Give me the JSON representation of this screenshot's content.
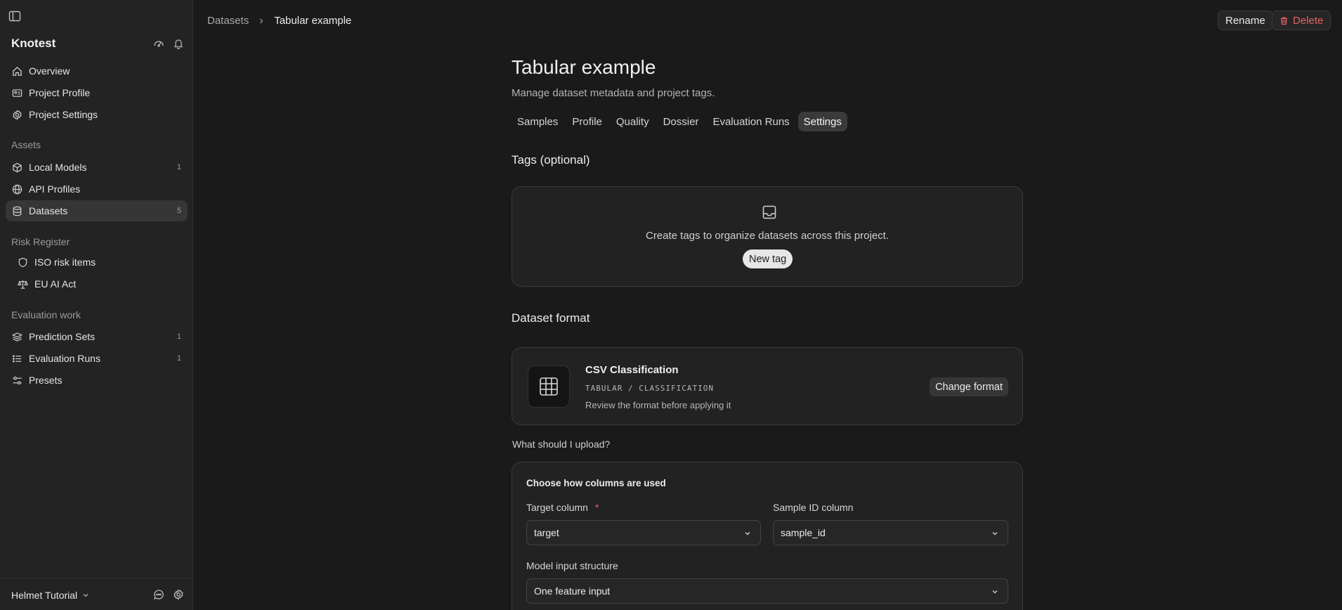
{
  "sidebar": {
    "title": "Knotest",
    "sections": {
      "assets": "Assets",
      "risk": "Risk Register",
      "evaluation": "Evaluation work"
    },
    "items": [
      {
        "label": "Overview",
        "icon": "home-icon"
      },
      {
        "label": "Project Profile",
        "icon": "id-card-icon"
      },
      {
        "label": "Project Settings",
        "icon": "gear-icon"
      },
      {
        "label": "Local Models",
        "icon": "cube-icon",
        "count": "1"
      },
      {
        "label": "API Profiles",
        "icon": "globe-icon"
      },
      {
        "label": "Datasets",
        "icon": "database-icon",
        "count": "5",
        "active": true
      },
      {
        "label": "ISO risk items",
        "icon": "shield-icon"
      },
      {
        "label": "EU AI Act",
        "icon": "scale-icon"
      },
      {
        "label": "Prediction Sets",
        "icon": "layers-icon",
        "count": "1"
      },
      {
        "label": "Evaluation Runs",
        "icon": "list-icon",
        "count": "1"
      },
      {
        "label": "Presets",
        "icon": "sliders-icon"
      }
    ],
    "footer": {
      "team": "Helmet Tutorial"
    }
  },
  "header": {
    "breadcrumb": [
      "Datasets",
      "Tabular example"
    ],
    "rename_label": "Rename",
    "delete_label": "Delete"
  },
  "main": {
    "title": "Tabular example",
    "subtitle": "Manage dataset metadata and project tags.",
    "tabs": [
      {
        "label": "Samples"
      },
      {
        "label": "Profile"
      },
      {
        "label": "Quality"
      },
      {
        "label": "Dossier"
      },
      {
        "label": "Evaluation Runs"
      },
      {
        "label": "Settings",
        "active": true
      }
    ],
    "tags": {
      "heading": "Tags (optional)",
      "empty_message": "Create tags to organize datasets across this project.",
      "new_tag_label": "New tag"
    },
    "format": {
      "heading": "Dataset format",
      "name": "CSV Classification",
      "kind": "TABULAR / CLASSIFICATION",
      "hint": "Review the format before applying it",
      "change_label": "Change format"
    },
    "upload_link": "What should I upload?",
    "columns": {
      "heading": "Choose how columns are used",
      "target_label": "Target column",
      "required_mark": "*",
      "target_value": "target",
      "sample_id_label": "Sample ID column",
      "sample_id_value": "sample_id",
      "input_structure_label": "Model input structure",
      "input_structure_value": "One feature input"
    }
  },
  "colors": {
    "background": "#1a1a1a",
    "sidebar": "#232323",
    "danger": "#e96060"
  }
}
